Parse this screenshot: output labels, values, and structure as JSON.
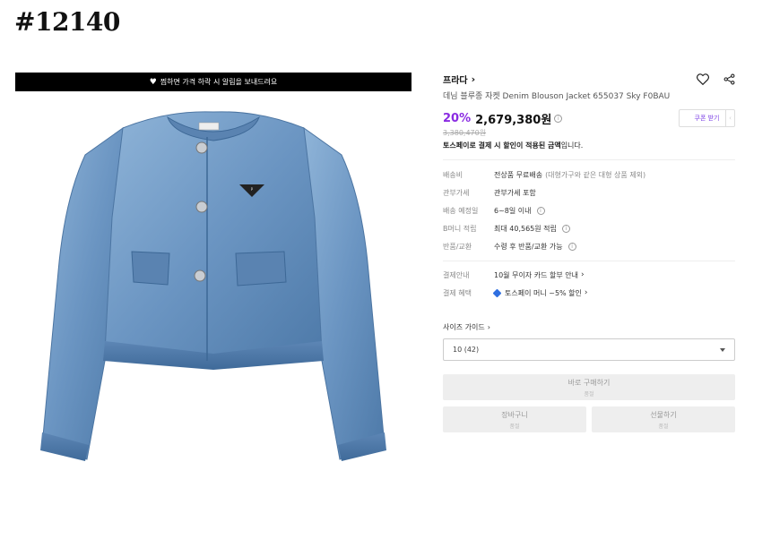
{
  "item_code": "#12140",
  "banner": {
    "icon": "heart-icon",
    "text": "찜하면 가격 하락 시 알림을 보내드려요"
  },
  "product": {
    "brand": "프라다",
    "name": "데님 블루종 자켓 Denim Blouson Jacket 655037 Sky F0BAU",
    "discount": "20%",
    "price": "2,679,380원",
    "original_price": "3,380,470원",
    "toss_note_bold": "토스페이로 결제 시 할인이 적용된 금액",
    "toss_note_rest": "입니다.",
    "coupon_label": "쿠폰 받기",
    "accent_color": "#8a2be2"
  },
  "details": [
    {
      "label": "배송비",
      "value": "전상품 무료배송",
      "sub": "(대형가구와 같은 대형 상품 제외)"
    },
    {
      "label": "관부가세",
      "value": "관부가세 포함"
    },
    {
      "label": "배송 예정일",
      "value": "6~8일 이내"
    },
    {
      "label": "B머니 적립",
      "value": "최대 40,565원 적립"
    },
    {
      "label": "반품/교환",
      "value": "수령 후 반품/교환 가능"
    }
  ],
  "payment": [
    {
      "label": "결제안내",
      "value": "10월 무이자 카드 할부 안내"
    },
    {
      "label": "결제 혜택",
      "value": "토스페이 머니 ~5% 할인"
    }
  ],
  "size_guide": "사이즈 가이드",
  "size_select": {
    "value": "10 (42)"
  },
  "buttons": {
    "buy_now": "바로 구매하기",
    "buy_now_sub": "품절",
    "cart": "장바구니",
    "cart_sub": "품절",
    "gift": "선물하기",
    "gift_sub": "품절"
  }
}
